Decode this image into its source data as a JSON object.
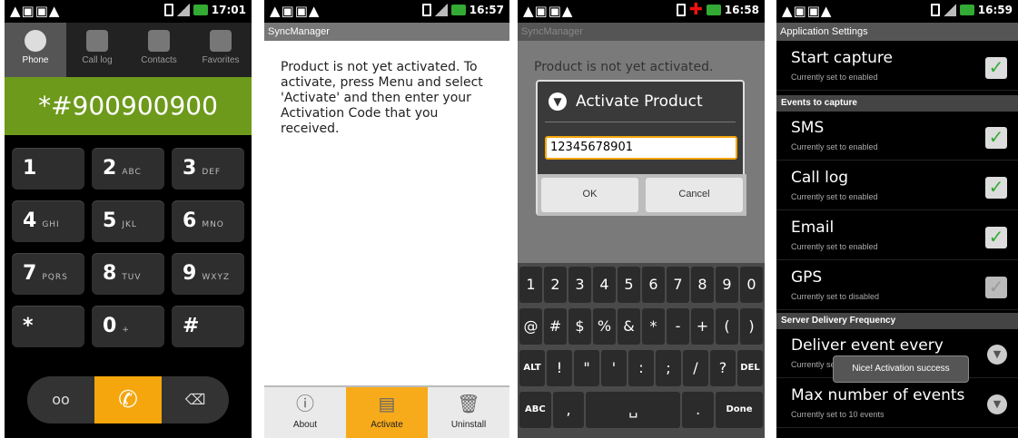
{
  "dialer": {
    "status_time": "17:01",
    "tabs": [
      {
        "label": "Phone"
      },
      {
        "label": "Call log"
      },
      {
        "label": "Contacts"
      },
      {
        "label": "Favorites"
      }
    ],
    "number": "*#900900900",
    "keys": [
      {
        "digit": "1",
        "letters": ""
      },
      {
        "digit": "2",
        "letters": "ABC"
      },
      {
        "digit": "3",
        "letters": "DEF"
      },
      {
        "digit": "4",
        "letters": "GHI"
      },
      {
        "digit": "5",
        "letters": "JKL"
      },
      {
        "digit": "6",
        "letters": "MNO"
      },
      {
        "digit": "7",
        "letters": "PQRS"
      },
      {
        "digit": "8",
        "letters": "TUV"
      },
      {
        "digit": "9",
        "letters": "WXYZ"
      },
      {
        "digit": "*",
        "letters": ""
      },
      {
        "digit": "0",
        "letters": "+"
      },
      {
        "digit": "#",
        "letters": ""
      }
    ]
  },
  "sync": {
    "status_time": "16:57",
    "title": "SyncManager",
    "message": "Product is not yet activated. To activate, press Menu and select 'Activate' and then enter your Activation Code that you received.",
    "menu": [
      {
        "label": "About"
      },
      {
        "label": "Activate"
      },
      {
        "label": "Uninstall"
      }
    ]
  },
  "activate": {
    "status_time": "16:58",
    "title": "SyncManager",
    "bg_message": "Product is not yet activated.",
    "dialog_title": "Activate Product",
    "code": "12345678901",
    "ok_label": "OK",
    "cancel_label": "Cancel",
    "kb_row1": [
      "1",
      "2",
      "3",
      "4",
      "5",
      "6",
      "7",
      "8",
      "9",
      "0"
    ],
    "kb_row2": [
      "@",
      "#",
      "$",
      "%",
      "&",
      "*",
      "-",
      "+",
      "(",
      ")"
    ],
    "kb_row3": [
      "ALT",
      "!",
      "\"",
      "'",
      ":",
      ";",
      "/",
      "?",
      "DEL"
    ],
    "kb_abc": "ABC",
    "kb_comma": ",",
    "kb_dot": ".",
    "kb_done": "Done"
  },
  "settings": {
    "status_time": "16:59",
    "title": "Application Settings",
    "section_events": "Events to capture",
    "section_server": "Server Delivery Frequency",
    "start_capture": {
      "title": "Start capture",
      "sub": "Currently set to enabled"
    },
    "sms": {
      "title": "SMS",
      "sub": "Currently set to enabled"
    },
    "calllog": {
      "title": "Call log",
      "sub": "Currently set to enabled"
    },
    "email": {
      "title": "Email",
      "sub": "Currently set to enabled"
    },
    "gps": {
      "title": "GPS",
      "sub": "Currently set to disabled"
    },
    "deliver": {
      "title": "Deliver event every",
      "sub": "Currently set to"
    },
    "maxevents": {
      "title": "Max number of events",
      "sub": "Currently set to 10 events"
    },
    "toast": "Nice! Activation success"
  }
}
